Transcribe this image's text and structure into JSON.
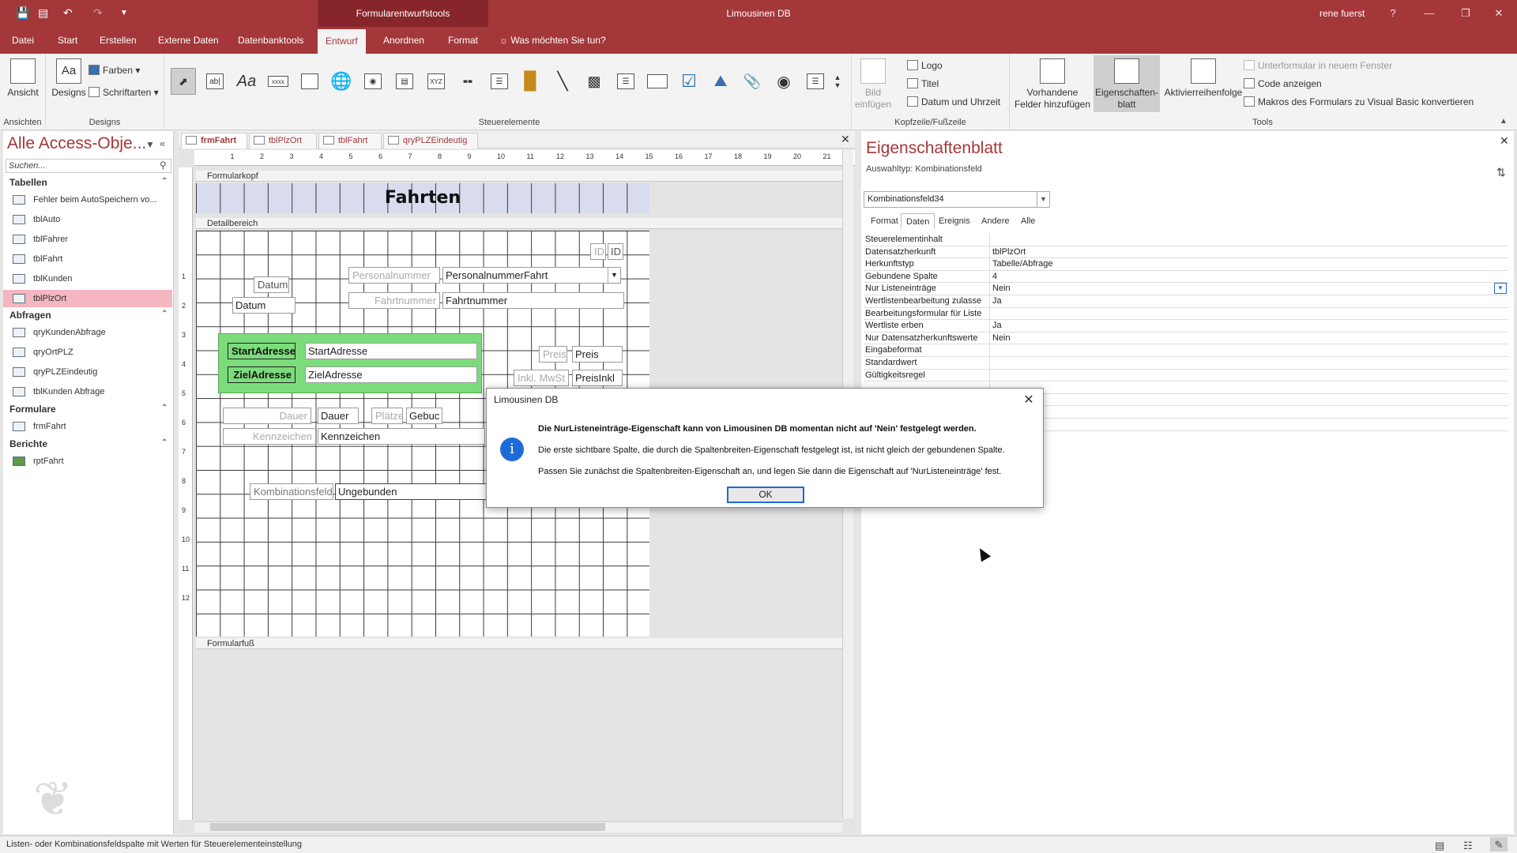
{
  "title_bar": {
    "contextual_group": "Formularentwurfstools",
    "app_title": "Limousinen DB",
    "user": "rene fuerst"
  },
  "ribbon_tabs": [
    "Datei",
    "Start",
    "Erstellen",
    "Externe Daten",
    "Datenbanktools",
    "Entwurf",
    "Anordnen",
    "Format"
  ],
  "tell_me": "Was möchten Sie tun?",
  "ribbon": {
    "ansicht": "Ansicht",
    "ansichten_group": "Ansichten",
    "designs": "Designs",
    "farben": "Farben",
    "schriftarten": "Schriftarten",
    "designs_group": "Designs",
    "steuerelemente_group": "Steuerelemente",
    "bild_einfuegen": "Bild einfügen",
    "logo": "Logo",
    "titel": "Titel",
    "datum_uhrzeit": "Datum und Uhrzeit",
    "kopf_group": "Kopfzeile/Fußzeile",
    "vorhandene_felder": "Vorhandene Felder hinzufügen",
    "eigenschaftenblatt": "Eigenschaften-blatt",
    "aktivierreihenfolge": "Aktivierreihenfolge",
    "unterformular": "Unterformular in neuem Fenster",
    "code_anzeigen": "Code anzeigen",
    "makros": "Makros des Formulars zu Visual Basic konvertieren",
    "tools_group": "Tools"
  },
  "nav": {
    "title": "Alle Access-Obje...",
    "search_placeholder": "Suchen...",
    "sections": [
      {
        "name": "Tabellen",
        "items": [
          "Fehler beim AutoSpeichern vo...",
          "tblAuto",
          "tblFahrer",
          "tblFahrt",
          "tblKunden",
          "tblPlzOrt"
        ]
      },
      {
        "name": "Abfragen",
        "items": [
          "qryKundenAbfrage",
          "qryOrtPLZ",
          "qryPLZEindeutig",
          "tblKunden Abfrage"
        ]
      },
      {
        "name": "Formulare",
        "items": [
          "frmFahrt"
        ]
      },
      {
        "name": "Berichte",
        "items": [
          "rptFahrt"
        ]
      }
    ]
  },
  "doc_tabs": [
    "frmFahrt",
    "tblPlzOrt",
    "tblFahrt",
    "qryPLZEindeutig"
  ],
  "form": {
    "header_section": "Formularkopf",
    "detail_section": "Detailbereich",
    "footer_section": "Formularfuß",
    "title": "Fahrten",
    "controls": {
      "id_label": "ID",
      "id_field": "ID",
      "datum_label": "Datum",
      "datum_field": "Datum",
      "personalnummer_label": "Personalnummer",
      "personalnummer_field": "PersonalnummerFahrt",
      "fahrtnummer_label": "Fahrtnummer",
      "fahrtnummer_field": "Fahrtnummer",
      "startadresse_label": "StartAdresse",
      "startadresse_field": "StartAdresse",
      "zieladresse_label": "ZielAdresse",
      "zieladresse_field": "ZielAdresse",
      "preis_label": "Preis",
      "preis_field": "Preis",
      "inkl_label": "Inkl. MwSt",
      "inkl_field": "PreisInkl",
      "dauer_label": "Dauer",
      "dauer_field": "Dauer",
      "plaetze_label": "Plätze",
      "gebucht_field": "Gebuc",
      "kennzeichen_label": "Kennzeichen",
      "kennzeichen_field": "Kennzeichen",
      "kombi_label": "Kombinationsfeld",
      "kombi_field": "Ungebunden"
    }
  },
  "props": {
    "title": "Eigenschaftenblatt",
    "selection_type": "Auswahltyp:  Kombinationsfeld",
    "selected_control": "Kombinationsfeld34",
    "tabs": [
      "Format",
      "Daten",
      "Ereignis",
      "Andere",
      "Alle"
    ],
    "rows": [
      {
        "k": "Steuerelementinhalt",
        "v": ""
      },
      {
        "k": "Datensatzherkunft",
        "v": "tblPlzOrt"
      },
      {
        "k": "Herkunftstyp",
        "v": "Tabelle/Abfrage"
      },
      {
        "k": "Gebundene Spalte",
        "v": "4"
      },
      {
        "k": "Nur Listeneinträge",
        "v": "Nein"
      },
      {
        "k": "Wertlistenbearbeitung zulasse",
        "v": "Ja"
      },
      {
        "k": "Bearbeitungsformular für Liste",
        "v": ""
      },
      {
        "k": "Wertliste erben",
        "v": "Ja"
      },
      {
        "k": "Nur Datensatzherkunftswerte",
        "v": "Nein"
      },
      {
        "k": "Eingabeformat",
        "v": ""
      },
      {
        "k": "Standardwert",
        "v": ""
      },
      {
        "k": "Gültigkeitsregel",
        "v": ""
      }
    ]
  },
  "dialog": {
    "title": "Limousinen DB",
    "line1": "Die NurListeneinträge-Eigenschaft kann von Limousinen DB momentan nicht auf 'Nein' festgelegt werden.",
    "line2": "Die erste sichtbare Spalte, die durch die Spaltenbreiten-Eigenschaft festgelegt ist, ist nicht gleich der gebundenen Spalte.",
    "line3": "Passen Sie zunächst die Spaltenbreiten-Eigenschaft an, und legen Sie dann die Eigenschaft auf 'NurListeneinträge' fest.",
    "ok": "OK"
  },
  "status": "Listen- oder Kombinationsfeldspalte mit Werten für Steuerelementeinstellung",
  "colors": {
    "accent": "#a4373a",
    "selection": "#f4b6c0",
    "highlight_green": "#7cdc7c",
    "info_blue": "#1e6ad6"
  }
}
